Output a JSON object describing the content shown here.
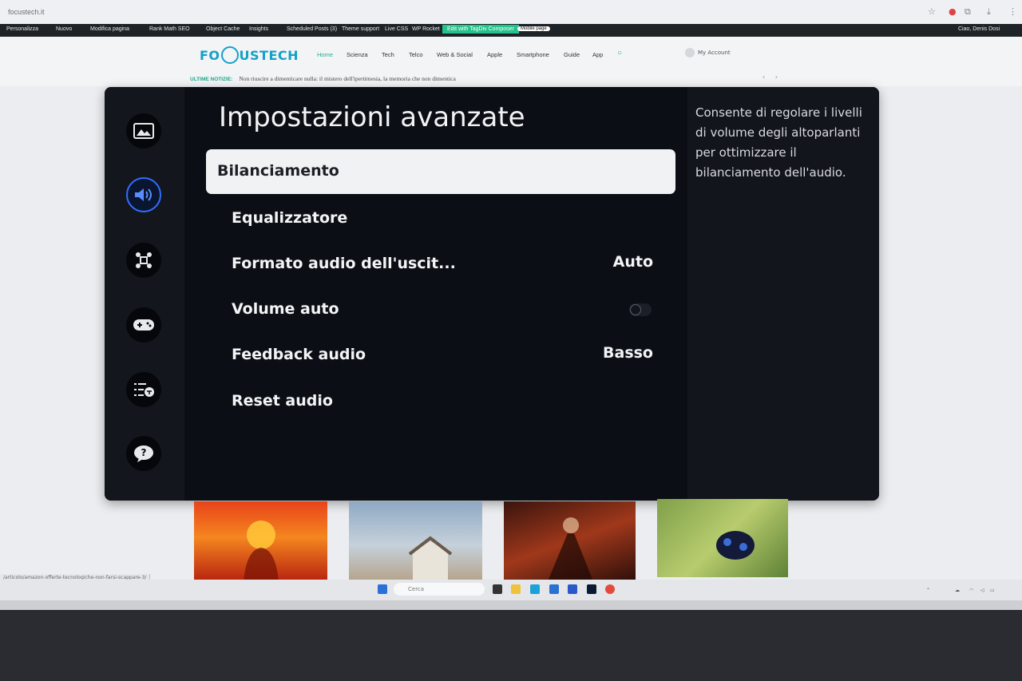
{
  "browser": {
    "url": "focustech.it"
  },
  "wp_admin_bar": {
    "items": [
      "Personalizza",
      "Nuovo",
      "Modifica pagina",
      "Rank Math SEO",
      "Object Cache",
      "Insights",
      "Scheduled Posts (3)",
      "Theme support",
      "Live CSS",
      "WP Rocket"
    ],
    "edit_button": "Edit with TagDiv Composer",
    "mobile_page": "Mobile page",
    "greeting": "Ciao, Denis Dosi"
  },
  "site": {
    "logo_left": "FO",
    "logo_right": "USTECH",
    "nav": [
      "Home",
      "Scienza",
      "Tech",
      "Telco",
      "Web & Social",
      "Apple",
      "Smartphone",
      "Guide",
      "App"
    ],
    "account": "My Account",
    "ticker_label": "ULTIME NOTIZIE:",
    "ticker_text": "Non riuscire a dimenticare nulla: il mistero dell'ipertimesia, la memoria che non dimentica"
  },
  "tv_menu": {
    "title": "Impostazioni avanzate",
    "items": [
      {
        "label": "Bilanciamento",
        "value": ""
      },
      {
        "label": "Equalizzatore",
        "value": ""
      },
      {
        "label": "Formato audio dell'uscit...",
        "value": "Auto"
      },
      {
        "label": "Volume auto",
        "value": ""
      },
      {
        "label": "Feedback audio",
        "value": "Basso"
      },
      {
        "label": "Reset audio",
        "value": ""
      }
    ],
    "volume_auto_on": false,
    "description": "Consente di regolare i livelli di volume degli altoparlanti per ottimizzare il bilanciamento dell'audio.",
    "side_icons": [
      "picture-icon",
      "sound-icon",
      "connection-icon",
      "gamepad-icon",
      "accessibility-icon",
      "support-icon"
    ],
    "accent_color": "#2f6fff"
  },
  "status_bar": {
    "url": "/articolo/amazon-offerte-tecnologiche-non-farsi-scappare-3/"
  },
  "taskbar": {
    "search_placeholder": "Cerca"
  }
}
